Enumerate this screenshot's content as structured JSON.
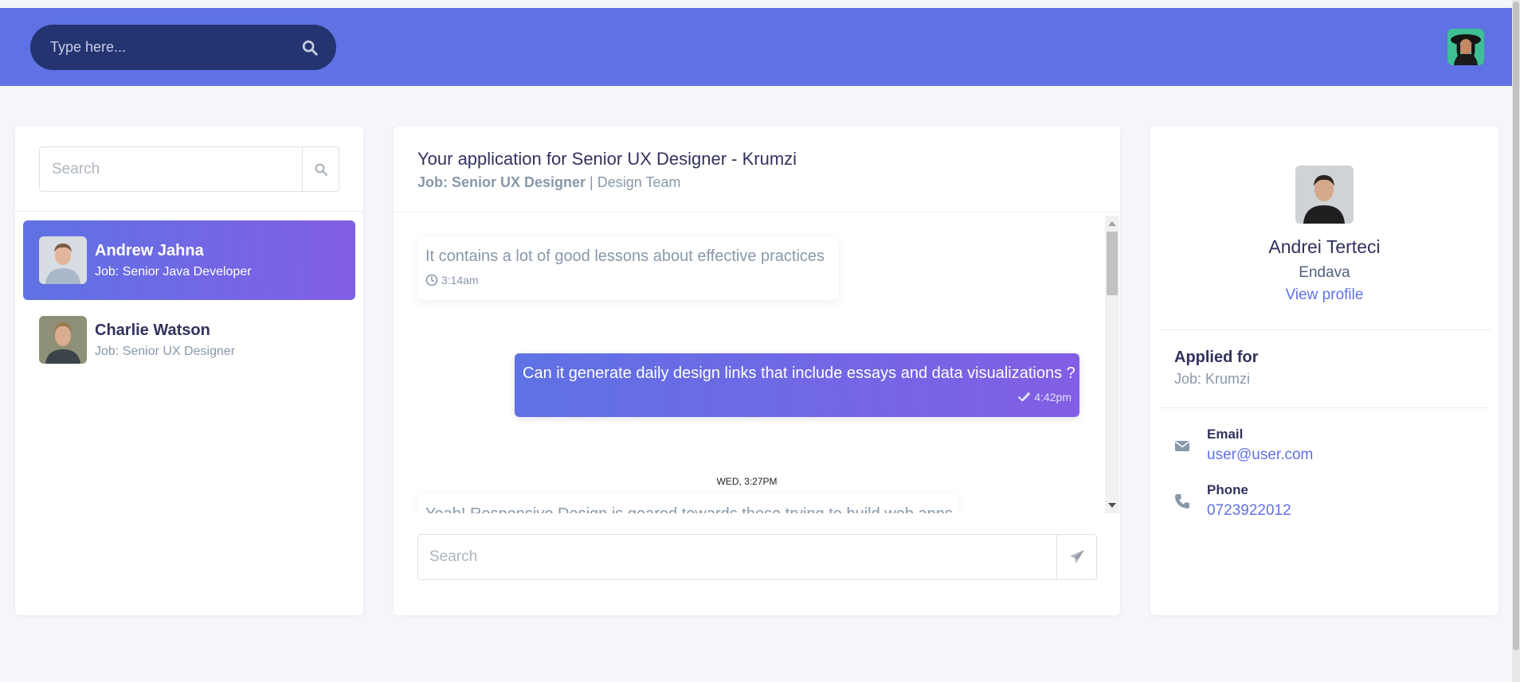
{
  "topbar": {
    "search_placeholder": "Type here...",
    "search_icon": "search-icon",
    "user_avatar": "user-avatar-photo"
  },
  "contacts": {
    "search_placeholder": "Search",
    "items": [
      {
        "name": "Andrew Jahna",
        "job": "Job: Senior Java Developer",
        "active": true
      },
      {
        "name": "Charlie Watson",
        "job": "Job: Senior UX Designer",
        "active": false
      }
    ]
  },
  "chat": {
    "title": "Your application for Senior UX Designer - Krumzi",
    "job_label": "Job: Senior UX Designer",
    "separator": " | ",
    "team": "Design Team",
    "messages": [
      {
        "direction": "in",
        "text": "It contains a lot of good lessons about effective practices",
        "time": "3:14am"
      },
      {
        "direction": "out",
        "text": "Can it generate daily design links that include essays and data visualizations ?",
        "time": "4:42pm"
      },
      {
        "direction": "in",
        "text": "Yeah! Responsive Design is geared towards those trying to build web apps",
        "time": ""
      }
    ],
    "day_separator": "WED, 3:27PM",
    "compose_placeholder": "Search",
    "send_icon": "paper-plane-icon"
  },
  "profile": {
    "name": "Andrei Terteci",
    "company": "Endava",
    "view_profile": "View profile",
    "applied_label": "Applied for",
    "applied_value": "Job: Krumzi",
    "email_label": "Email",
    "email_value": "user@user.com",
    "phone_label": "Phone",
    "phone_value": "0723922012"
  },
  "colors": {
    "primary": "#5e72e4",
    "gradient_end": "#825ee4",
    "heading": "#32325d",
    "muted": "#8898aa",
    "search_pill": "#243470"
  }
}
